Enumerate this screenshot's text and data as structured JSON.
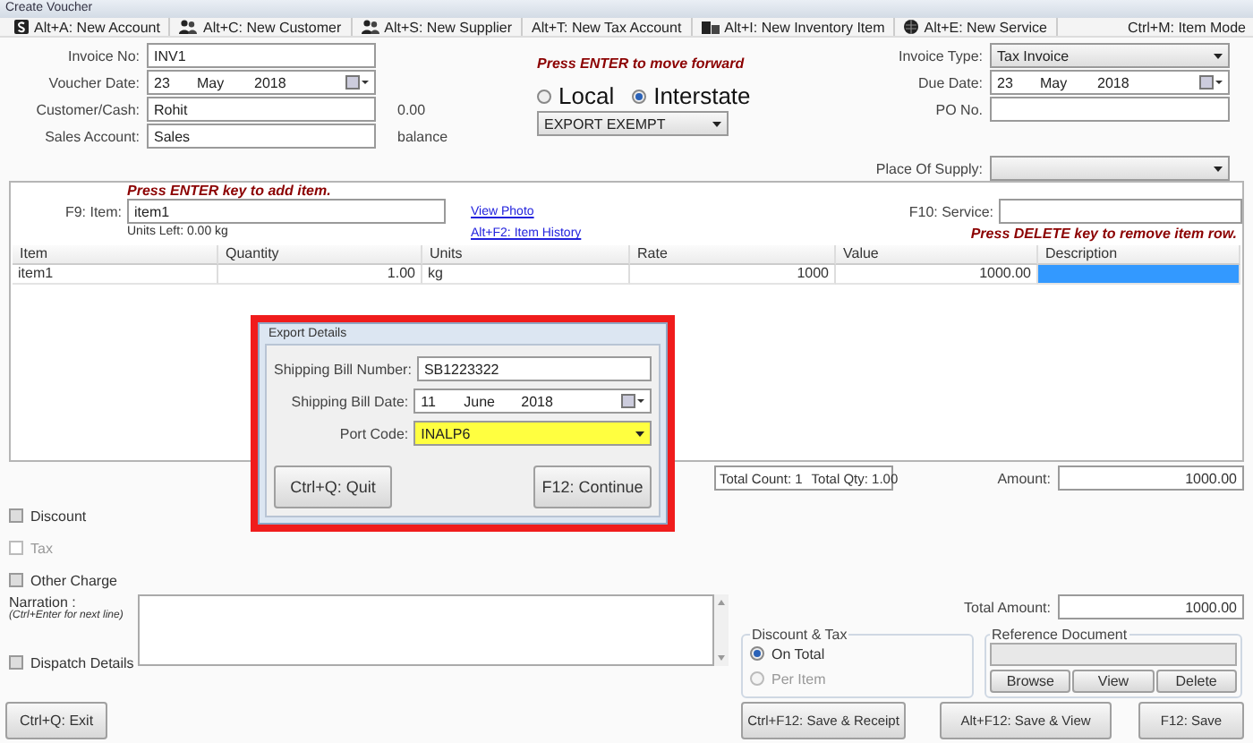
{
  "window": {
    "title": "Create Voucher"
  },
  "toolbar": [
    {
      "label": "Alt+A: New Account"
    },
    {
      "label": "Alt+C: New Customer"
    },
    {
      "label": "Alt+S: New Supplier"
    },
    {
      "label": "Alt+T: New Tax Account"
    },
    {
      "label": "Alt+I: New Inventory Item"
    },
    {
      "label": "Alt+E: New Service"
    }
  ],
  "toolbar_shortcut": "Ctrl+M: Item Mode",
  "header": {
    "hint": "Press ENTER to move forward",
    "left_fields": [
      {
        "label": "Invoice No:",
        "kind": "text",
        "value": "INV1"
      },
      {
        "label": "Voucher Date:",
        "kind": "date",
        "day": "23",
        "month": "May",
        "year": "2018"
      },
      {
        "label": "Customer/Cash:",
        "kind": "text",
        "value": "Rohit",
        "note": "0.00"
      },
      {
        "label": "Sales Account:",
        "kind": "text",
        "value": "Sales",
        "note": "balance"
      }
    ],
    "supply_type": [
      {
        "label": "Local",
        "selected": false
      },
      {
        "label": "Interstate",
        "selected": true
      }
    ],
    "tax_category": "EXPORT EXEMPT",
    "right_fields": [
      {
        "label": "Invoice Type:",
        "kind": "select",
        "value": "Tax Invoice"
      },
      {
        "label": "Due Date:",
        "kind": "date",
        "day": "23",
        "month": "May",
        "year": "2018"
      },
      {
        "label": "PO No.",
        "kind": "text"
      },
      {
        "label": "Place Of Supply:",
        "kind": "select"
      }
    ]
  },
  "item_entry": {
    "hint": "Press ENTER key to add item.",
    "item_label": "F9: Item:",
    "item_value": "item1",
    "units_left": "Units Left:  0.00 kg",
    "links": [
      "View Photo",
      "Alt+F2: Item History"
    ],
    "service_label": "F10: Service:",
    "delete_hint": "Press DELETE key to remove item row."
  },
  "table": {
    "columns": [
      "Item",
      "Quantity",
      "Units",
      "Rate",
      "Value",
      "Description"
    ],
    "rows": [
      {
        "cells": [
          "item1",
          "1.00",
          "kg",
          "1000",
          "1000.00"
        ],
        "description_selected": true
      }
    ]
  },
  "totals": {
    "total_count": "Total Count: 1",
    "total_qty": "Total Qty: 1.00",
    "amount_label": "Amount:",
    "amount": "1000.00",
    "total_amount_label": "Total Amount:",
    "total_amount": "1000.00"
  },
  "options": [
    {
      "label": "Discount",
      "checked": false,
      "disabled": false
    },
    {
      "label": "Tax",
      "checked": false,
      "disabled": true
    },
    {
      "label": "Other Charge",
      "checked": false,
      "disabled": false
    }
  ],
  "narration": {
    "label": "Narration :",
    "hint": "(Ctrl+Enter for next line)"
  },
  "dispatch": {
    "label": "Dispatch Details",
    "checked": false
  },
  "discount_tax": {
    "title": "Discount & Tax",
    "options": [
      {
        "label": "On Total",
        "selected": true,
        "disabled": false
      },
      {
        "label": "Per Item",
        "selected": false,
        "disabled": true
      }
    ]
  },
  "reference": {
    "title": "Reference Document",
    "buttons": [
      "Browse",
      "View",
      "Delete"
    ]
  },
  "exit_button": "Ctrl+Q: Exit",
  "footer_buttons": [
    "Ctrl+F12: Save & Receipt",
    "Alt+F12: Save & View",
    "F12: Save"
  ],
  "dialog": {
    "title": "Export Details",
    "fields": [
      {
        "label": "Shipping Bill Number:",
        "kind": "text",
        "value": "SB1223322"
      },
      {
        "label": "Shipping Bill Date:",
        "kind": "date",
        "day": "11",
        "month": "June",
        "year": "2018"
      },
      {
        "label": "Port Code:",
        "kind": "select",
        "value": "INALP6",
        "highlighted": true
      }
    ],
    "buttons": [
      "Ctrl+Q: Quit",
      "F12: Continue"
    ]
  }
}
